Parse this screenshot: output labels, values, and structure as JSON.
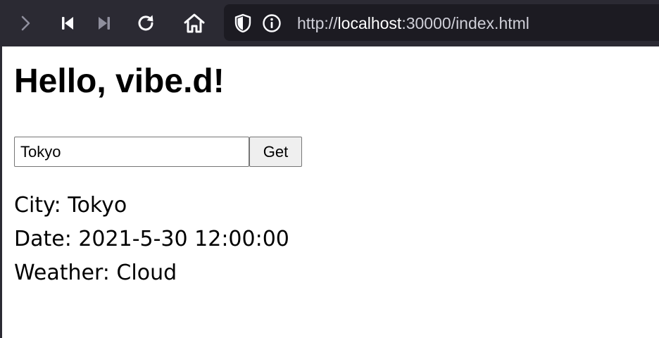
{
  "browser": {
    "url_prefix": "http://",
    "url_host": "localhost",
    "url_rest": ":30000/index.html",
    "icons": [
      "forward-icon",
      "skip-back-icon",
      "skip-forward-icon",
      "reload-icon",
      "home-icon",
      "shield-icon",
      "info-icon"
    ],
    "colors": {
      "toolbar_bg": "#2b2a33",
      "urlbar_bg": "#1c1b22",
      "icon_active": "#fbfbfe",
      "icon_dim": "#8f8f9d"
    }
  },
  "page": {
    "title": "Hello, vibe.d!",
    "city_input_value": "Tokyo",
    "get_button_label": "Get",
    "city_line": "City: Tokyo",
    "date_line": "Date: 2021-5-30 12:00:00",
    "weather_line": "Weather: Cloud"
  }
}
